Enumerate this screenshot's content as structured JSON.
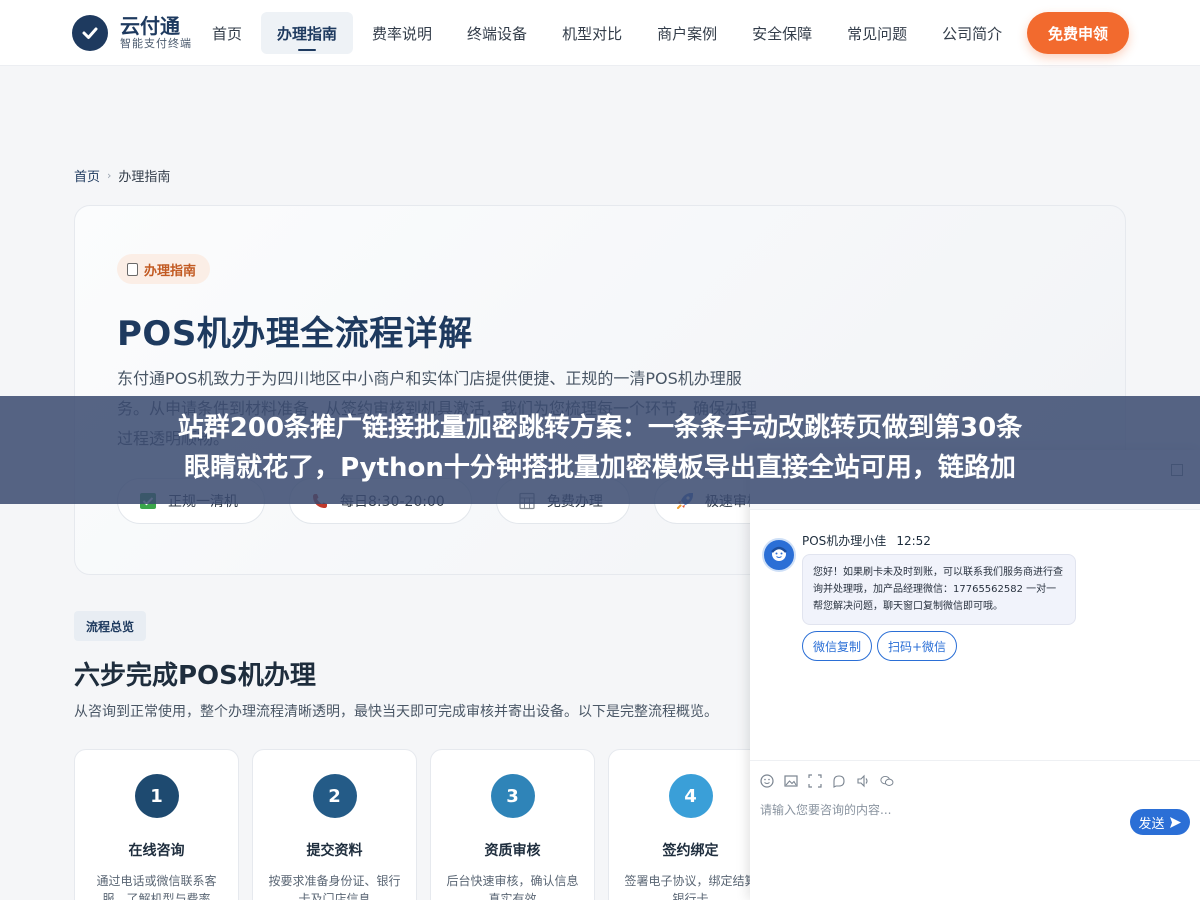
{
  "header": {
    "logo_name": "云付通",
    "logo_sub": "智能支付终端",
    "nav": [
      "首页",
      "办理指南",
      "费率说明",
      "终端设备",
      "机型对比",
      "商户案例",
      "安全保障",
      "常见问题",
      "公司简介"
    ],
    "active_index": 1,
    "cta_label": "免费申领"
  },
  "breadcrumb": {
    "home": "首页",
    "sep": "›",
    "current": "办理指南"
  },
  "hero": {
    "tag": "办理指南",
    "title": "POS机办理全流程详解",
    "desc": "东付通POS机致力于为四川地区中小商户和实体门店提供便捷、正规的一清POS机办理服务。从申请条件到材料准备，从签约审核到机具激活，我们为您梳理每一个环节，确保办理过程透明顺畅。",
    "features": [
      "正规一清机",
      "每日8:30-20:00",
      "免费办理",
      "极速审核"
    ]
  },
  "process": {
    "tag": "流程总览",
    "title": "六步完成POS机办理",
    "desc": "从咨询到正常使用，整个办理流程清晰透明，最快当天即可完成审核并寄出设备。以下是完整流程概览。",
    "steps": [
      {
        "num": "1",
        "title": "在线咨询",
        "desc": "通过电话或微信联系客服，了解机型与费率",
        "color": "#1e4a70"
      },
      {
        "num": "2",
        "title": "提交资料",
        "desc": "按要求准备身份证、银行卡及门店信息",
        "color": "#245b87"
      },
      {
        "num": "3",
        "title": "资质审核",
        "desc": "后台快速审核，确认信息真实有效",
        "color": "#2f84b8"
      },
      {
        "num": "4",
        "title": "签约绑定",
        "desc": "签署电子协议，绑定结算银行卡",
        "color": "#3a9fd8"
      }
    ]
  },
  "banner": {
    "line1": "站群200条推广链接批量加密跳转方案：一条条手动改跳转页做到第30条",
    "line2": "眼睛就花了，Python十分钟搭批量加密模板导出直接全站可用，链路加"
  },
  "chat": {
    "agent_name": "POS机办理小佳",
    "time": "12:52",
    "message": "您好！如果刷卡未及时到账，可以联系我们服务商进行查询并处理哦，加产品经理微信：17765562582 一对一帮您解决问题，聊天窗口复制微信即可哦。",
    "quick_replies": [
      "微信复制",
      "扫码+微信"
    ],
    "tools": [
      "emoji-icon",
      "image-icon",
      "screenshot-icon",
      "like-icon",
      "voice-icon",
      "wechat-icon"
    ],
    "input_placeholder": "请输入您要咨询的内容...",
    "send_label": "发送"
  },
  "colors": {
    "brand": "#1e3a5f",
    "accent": "#f26a2e",
    "chat_blue": "#2b6fd6"
  }
}
